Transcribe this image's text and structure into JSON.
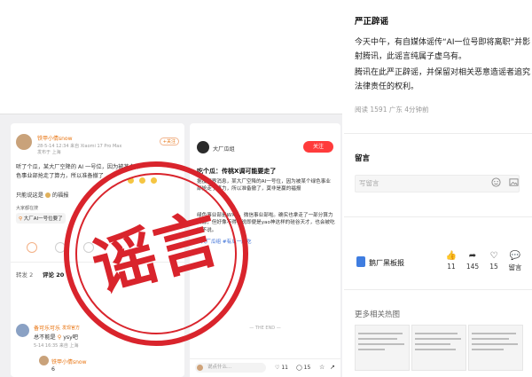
{
  "post": {
    "username": "铁甲小倩snow",
    "timestamp": "28-5-14 12:34 来自 Xiaomi 17 Pro Max",
    "ip": "发布于 上海",
    "follow_chip": "+关注",
    "body_lines": [
      "听了个瓜，某大厂空降的 AI 一号位，因为被某个绿",
      "色事业部抢走了算力，所以准备撤了"
    ],
    "footer_line": "只能说这是",
    "footer_tail": "的福报",
    "topic_caption": "大家都在搜",
    "topic": "大厂AI一号位要了",
    "tabs": [
      "转发 2",
      "评论 20"
    ],
    "reply": {
      "username": "备可乐可乐",
      "badge": "发现官方",
      "text": "总不能是",
      "text_tail": "ysy吧",
      "meta": "5-14 16:35 来自 上海",
      "sub_username": "铁甲小倩snow",
      "sub_tail": "6"
    }
  },
  "panel": {
    "account": "大厂瓜组",
    "follow": "关注",
    "headline": "吃个瓜：传桃X调可能要走了",
    "para1": "据投资界消息，某大厂空降的AI一号位，因为被某个绿色事业部抢走了算力，所以准备撤了，莫非是赢的福报",
    "para2": "绿色事业部是WXG，微信事业部啦。确实也拿走了一部分算力资源，但好像不得不说即便是yao神这样的硅谷天才，也会被吃干不说。",
    "tags": "#大厂瓜组 #有瓜一起吃",
    "end": "THE END",
    "input_placeholder": "说点什么...",
    "likes": "11",
    "comments": "15"
  },
  "stamp": {
    "text": "谣言",
    "color": "#d9242c"
  },
  "article": {
    "title": "严正辟谣",
    "para1": "今天中午，有自媒体谣传“AI一位号即将离职”并影射腾讯，此谣言纯属子虚乌有。",
    "para2": "腾讯在此严正辟谣，并保留对相关恶意造谣者追究法律责任的权利。",
    "meta": "阅读 1591   广东   4分钟前"
  },
  "comments": {
    "title": "留言",
    "placeholder": "写留言"
  },
  "account": {
    "name": "鹅厂黑板报",
    "stats": [
      {
        "icon": "thumb-up-icon",
        "value": "11"
      },
      {
        "icon": "share-icon",
        "value": "145"
      },
      {
        "icon": "like-icon",
        "value": "15"
      },
      {
        "icon": "comment-icon",
        "value": "留言"
      }
    ]
  },
  "more": {
    "title": "更多相关热图"
  }
}
